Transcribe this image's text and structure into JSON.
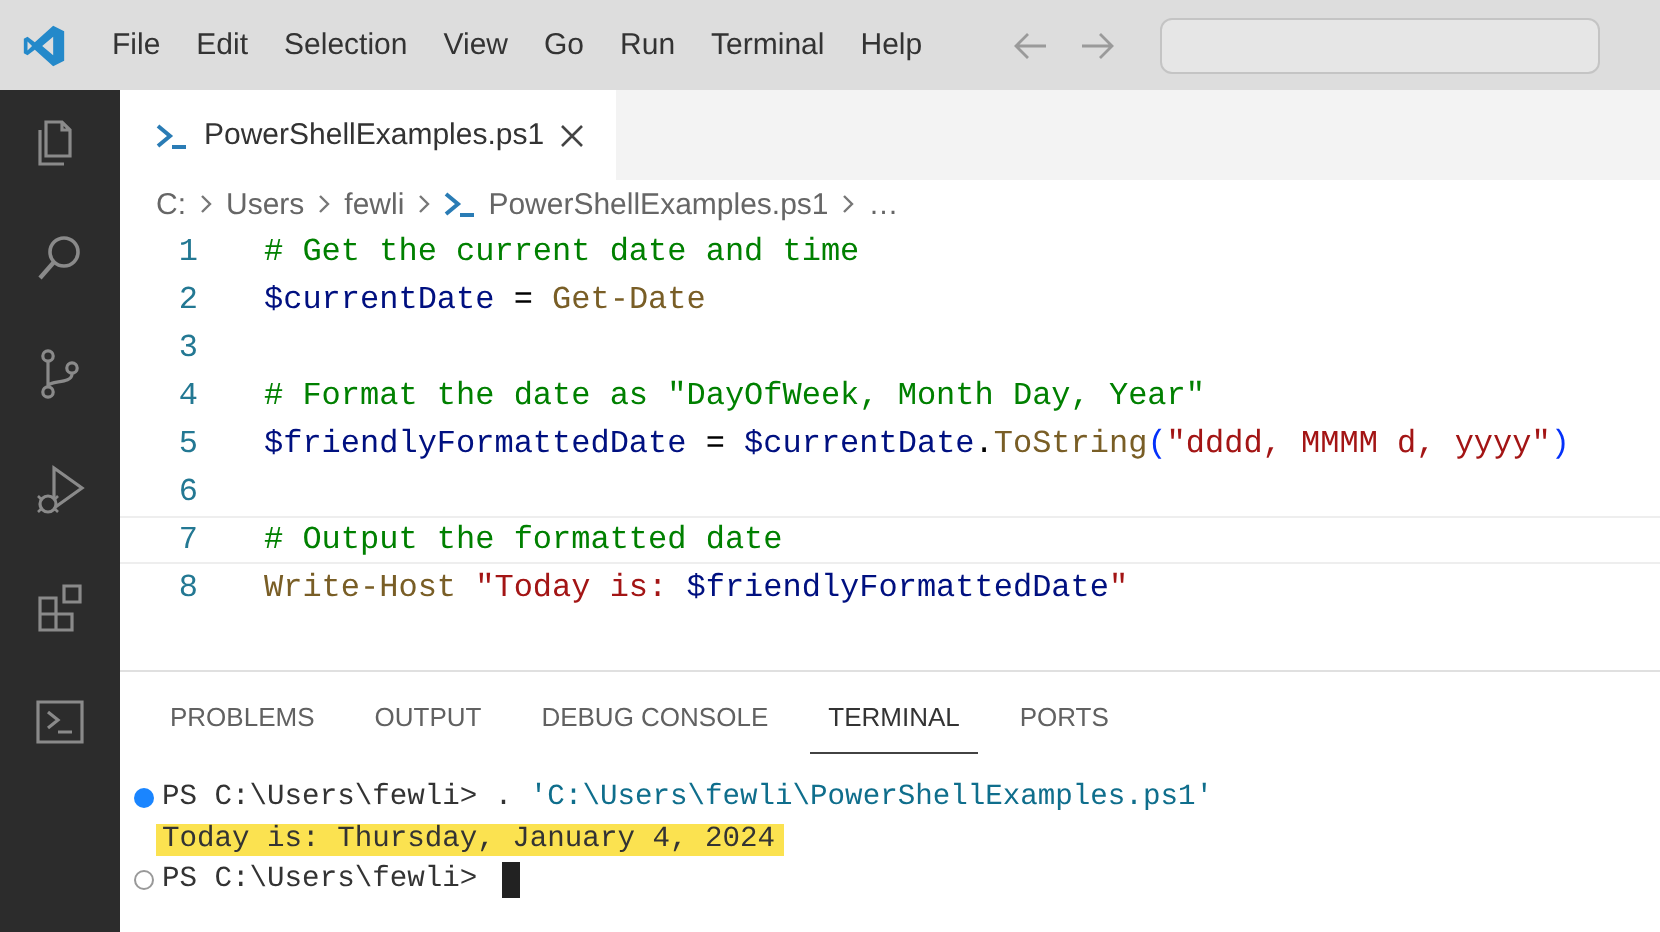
{
  "menu": [
    "File",
    "Edit",
    "Selection",
    "View",
    "Go",
    "Run",
    "Terminal",
    "Help"
  ],
  "activity_bar": [
    {
      "kind": "files"
    },
    {
      "kind": "search"
    },
    {
      "kind": "source-control"
    },
    {
      "kind": "run-debug"
    },
    {
      "kind": "extensions"
    },
    {
      "kind": "terminal"
    }
  ],
  "editor_tabs": [
    {
      "label": "PowerShellExamples.ps1",
      "selected": true
    }
  ],
  "breadcrumb": [
    {
      "kind": "folder",
      "text": "C:"
    },
    {
      "kind": "folder",
      "text": "Users"
    },
    {
      "kind": "folder",
      "text": "fewli"
    },
    {
      "kind": "file",
      "text": "PowerShellExamples.ps1"
    },
    {
      "kind": "more",
      "text": "…"
    }
  ],
  "code_lines": [
    {
      "number": "1",
      "current": false,
      "tokens": [
        {
          "kind": "comment",
          "text": "# Get the current date and time"
        }
      ]
    },
    {
      "number": "2",
      "current": false,
      "tokens": [
        {
          "kind": "variable",
          "text": "$currentDate"
        },
        {
          "kind": "plain",
          "text": " = "
        },
        {
          "kind": "command",
          "text": "Get-Date"
        }
      ]
    },
    {
      "number": "3",
      "current": false
    },
    {
      "number": "4",
      "current": false,
      "tokens": [
        {
          "kind": "comment",
          "text": "# Format the date as \"DayOfWeek, Month Day, Year\""
        }
      ]
    },
    {
      "number": "5",
      "current": false,
      "tokens": [
        {
          "kind": "variable",
          "text": "$friendlyFormattedDate"
        },
        {
          "kind": "plain",
          "text": " = "
        },
        {
          "kind": "variable",
          "text": "$currentDate"
        },
        {
          "kind": "plain",
          "text": "."
        },
        {
          "kind": "command",
          "text": "ToString"
        },
        {
          "kind": "bracket",
          "text": "("
        },
        {
          "kind": "string",
          "text": "\"dddd, MMMM d, yyyy\""
        },
        {
          "kind": "bracket",
          "text": ")"
        }
      ]
    },
    {
      "number": "6",
      "current": false
    },
    {
      "number": "7",
      "current": true,
      "tokens": [
        {
          "kind": "comment",
          "text": "# Output the formatted date"
        }
      ]
    },
    {
      "number": "8",
      "current": false,
      "tokens": [
        {
          "kind": "command",
          "text": "Write-Host"
        },
        {
          "kind": "string",
          "text": " \"Today is: "
        },
        {
          "kind": "variable",
          "text": "$friendlyFormattedDate"
        },
        {
          "kind": "string",
          "text": "\""
        }
      ]
    }
  ],
  "panel_tabs": [
    {
      "label": "PROBLEMS",
      "selected": false
    },
    {
      "label": "OUTPUT",
      "selected": false
    },
    {
      "label": "DEBUG CONSOLE",
      "selected": false
    },
    {
      "label": "TERMINAL",
      "selected": true
    },
    {
      "label": "PORTS",
      "selected": false
    }
  ],
  "terminal_lines": [
    {
      "command_done": true,
      "highlighted": false,
      "cursor": false,
      "segments": [
        {
          "kind": "plain",
          "text": "PS C:\\Users\\fewli> . "
        },
        {
          "kind": "path",
          "text": "'C:\\Users\\fewli\\PowerShellExamples.ps1'"
        }
      ]
    },
    {
      "highlighted": true,
      "cursor": false,
      "segments": [
        {
          "kind": "plain",
          "text": "Today is: Thursday, January 4, 2024"
        }
      ]
    },
    {
      "command_done": false,
      "highlighted": false,
      "cursor": true,
      "segments": [
        {
          "kind": "plain",
          "text": "PS C:\\Users\\fewli> "
        }
      ]
    }
  ]
}
